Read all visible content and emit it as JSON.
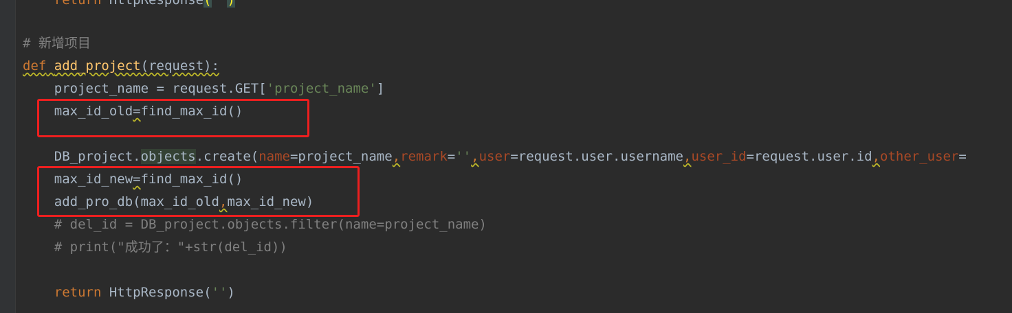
{
  "code": {
    "top_line": {
      "indent": "    ",
      "kw": "return",
      "rest": " HttpResponse",
      "open": "(",
      "str": "''",
      "close": ")"
    },
    "comment_cn": "# 新增项目",
    "def_line": {
      "kw": "def",
      "name": "add_project",
      "sig": "(request):"
    },
    "line_project_name": {
      "indent": "    ",
      "pre": "project_name = request.GET[",
      "str": "'project_name'",
      "post": "]"
    },
    "line_max_id_old": {
      "indent": "    ",
      "var": "max_id_old",
      "eq": "=",
      "call": "find_max_id()"
    },
    "line_create": {
      "indent": "    ",
      "pre": "DB_project.",
      "obj": "objects",
      "mid": ".create(",
      "p1": "name",
      "v1": "=project_name",
      "c1": ",",
      "p2": "remark",
      "v2eq": "=",
      "v2": "''",
      "c2": ",",
      "p3": "user",
      "v3": "=request.user.username",
      "c3": ",",
      "p4": "user_id",
      "v4": "=request.user.id",
      "c4": ",",
      "p5": "other_user",
      "v5": "="
    },
    "line_max_id_new": {
      "indent": "    ",
      "var": "max_id_new",
      "eq": "=",
      "call": "find_max_id()"
    },
    "line_add_pro_db": {
      "indent": "    ",
      "pre": "add_pro_db(max_id_old",
      "comma": ",",
      "post": "max_id_new)"
    },
    "line_cmt_del": "    # del_id = DB_project.objects.filter(name=project_name)",
    "line_cmt_print": "    # print(\"成功了：\"+str(del_id))",
    "line_return": {
      "indent": "    ",
      "kw": "return",
      "rest": " HttpResponse(",
      "str": "''",
      "close": ")"
    }
  },
  "colors": {
    "background": "#2b2b2b",
    "keyword": "#cc7832",
    "function": "#ffc66d",
    "string": "#6a8759",
    "comment": "#808080",
    "param": "#aa4926",
    "highlight_box": "#ee1f1f"
  }
}
